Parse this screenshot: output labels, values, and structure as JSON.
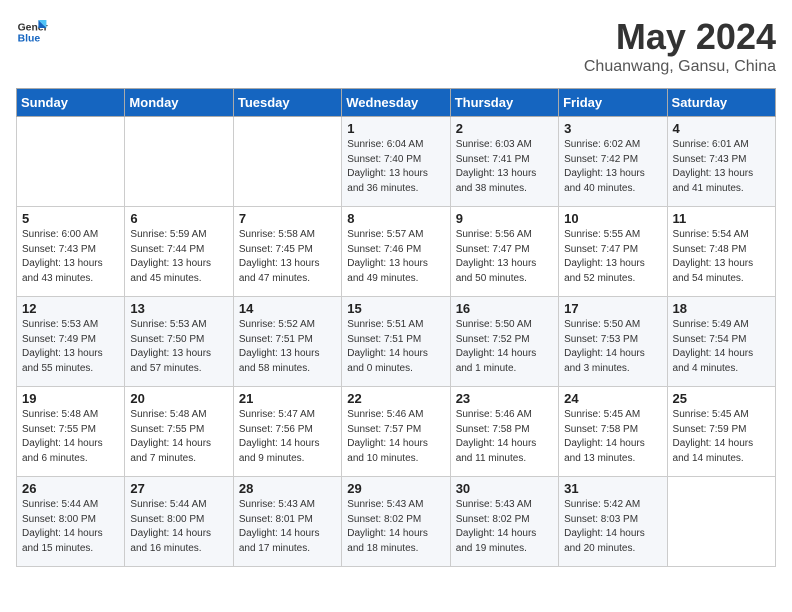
{
  "header": {
    "logo_line1": "General",
    "logo_line2": "Blue",
    "month": "May 2024",
    "location": "Chuanwang, Gansu, China"
  },
  "weekdays": [
    "Sunday",
    "Monday",
    "Tuesday",
    "Wednesday",
    "Thursday",
    "Friday",
    "Saturday"
  ],
  "weeks": [
    [
      {
        "day": "",
        "info": ""
      },
      {
        "day": "",
        "info": ""
      },
      {
        "day": "",
        "info": ""
      },
      {
        "day": "1",
        "info": "Sunrise: 6:04 AM\nSunset: 7:40 PM\nDaylight: 13 hours\nand 36 minutes."
      },
      {
        "day": "2",
        "info": "Sunrise: 6:03 AM\nSunset: 7:41 PM\nDaylight: 13 hours\nand 38 minutes."
      },
      {
        "day": "3",
        "info": "Sunrise: 6:02 AM\nSunset: 7:42 PM\nDaylight: 13 hours\nand 40 minutes."
      },
      {
        "day": "4",
        "info": "Sunrise: 6:01 AM\nSunset: 7:43 PM\nDaylight: 13 hours\nand 41 minutes."
      }
    ],
    [
      {
        "day": "5",
        "info": "Sunrise: 6:00 AM\nSunset: 7:43 PM\nDaylight: 13 hours\nand 43 minutes."
      },
      {
        "day": "6",
        "info": "Sunrise: 5:59 AM\nSunset: 7:44 PM\nDaylight: 13 hours\nand 45 minutes."
      },
      {
        "day": "7",
        "info": "Sunrise: 5:58 AM\nSunset: 7:45 PM\nDaylight: 13 hours\nand 47 minutes."
      },
      {
        "day": "8",
        "info": "Sunrise: 5:57 AM\nSunset: 7:46 PM\nDaylight: 13 hours\nand 49 minutes."
      },
      {
        "day": "9",
        "info": "Sunrise: 5:56 AM\nSunset: 7:47 PM\nDaylight: 13 hours\nand 50 minutes."
      },
      {
        "day": "10",
        "info": "Sunrise: 5:55 AM\nSunset: 7:47 PM\nDaylight: 13 hours\nand 52 minutes."
      },
      {
        "day": "11",
        "info": "Sunrise: 5:54 AM\nSunset: 7:48 PM\nDaylight: 13 hours\nand 54 minutes."
      }
    ],
    [
      {
        "day": "12",
        "info": "Sunrise: 5:53 AM\nSunset: 7:49 PM\nDaylight: 13 hours\nand 55 minutes."
      },
      {
        "day": "13",
        "info": "Sunrise: 5:53 AM\nSunset: 7:50 PM\nDaylight: 13 hours\nand 57 minutes."
      },
      {
        "day": "14",
        "info": "Sunrise: 5:52 AM\nSunset: 7:51 PM\nDaylight: 13 hours\nand 58 minutes."
      },
      {
        "day": "15",
        "info": "Sunrise: 5:51 AM\nSunset: 7:51 PM\nDaylight: 14 hours\nand 0 minutes."
      },
      {
        "day": "16",
        "info": "Sunrise: 5:50 AM\nSunset: 7:52 PM\nDaylight: 14 hours\nand 1 minute."
      },
      {
        "day": "17",
        "info": "Sunrise: 5:50 AM\nSunset: 7:53 PM\nDaylight: 14 hours\nand 3 minutes."
      },
      {
        "day": "18",
        "info": "Sunrise: 5:49 AM\nSunset: 7:54 PM\nDaylight: 14 hours\nand 4 minutes."
      }
    ],
    [
      {
        "day": "19",
        "info": "Sunrise: 5:48 AM\nSunset: 7:55 PM\nDaylight: 14 hours\nand 6 minutes."
      },
      {
        "day": "20",
        "info": "Sunrise: 5:48 AM\nSunset: 7:55 PM\nDaylight: 14 hours\nand 7 minutes."
      },
      {
        "day": "21",
        "info": "Sunrise: 5:47 AM\nSunset: 7:56 PM\nDaylight: 14 hours\nand 9 minutes."
      },
      {
        "day": "22",
        "info": "Sunrise: 5:46 AM\nSunset: 7:57 PM\nDaylight: 14 hours\nand 10 minutes."
      },
      {
        "day": "23",
        "info": "Sunrise: 5:46 AM\nSunset: 7:58 PM\nDaylight: 14 hours\nand 11 minutes."
      },
      {
        "day": "24",
        "info": "Sunrise: 5:45 AM\nSunset: 7:58 PM\nDaylight: 14 hours\nand 13 minutes."
      },
      {
        "day": "25",
        "info": "Sunrise: 5:45 AM\nSunset: 7:59 PM\nDaylight: 14 hours\nand 14 minutes."
      }
    ],
    [
      {
        "day": "26",
        "info": "Sunrise: 5:44 AM\nSunset: 8:00 PM\nDaylight: 14 hours\nand 15 minutes."
      },
      {
        "day": "27",
        "info": "Sunrise: 5:44 AM\nSunset: 8:00 PM\nDaylight: 14 hours\nand 16 minutes."
      },
      {
        "day": "28",
        "info": "Sunrise: 5:43 AM\nSunset: 8:01 PM\nDaylight: 14 hours\nand 17 minutes."
      },
      {
        "day": "29",
        "info": "Sunrise: 5:43 AM\nSunset: 8:02 PM\nDaylight: 14 hours\nand 18 minutes."
      },
      {
        "day": "30",
        "info": "Sunrise: 5:43 AM\nSunset: 8:02 PM\nDaylight: 14 hours\nand 19 minutes."
      },
      {
        "day": "31",
        "info": "Sunrise: 5:42 AM\nSunset: 8:03 PM\nDaylight: 14 hours\nand 20 minutes."
      },
      {
        "day": "",
        "info": ""
      }
    ]
  ]
}
